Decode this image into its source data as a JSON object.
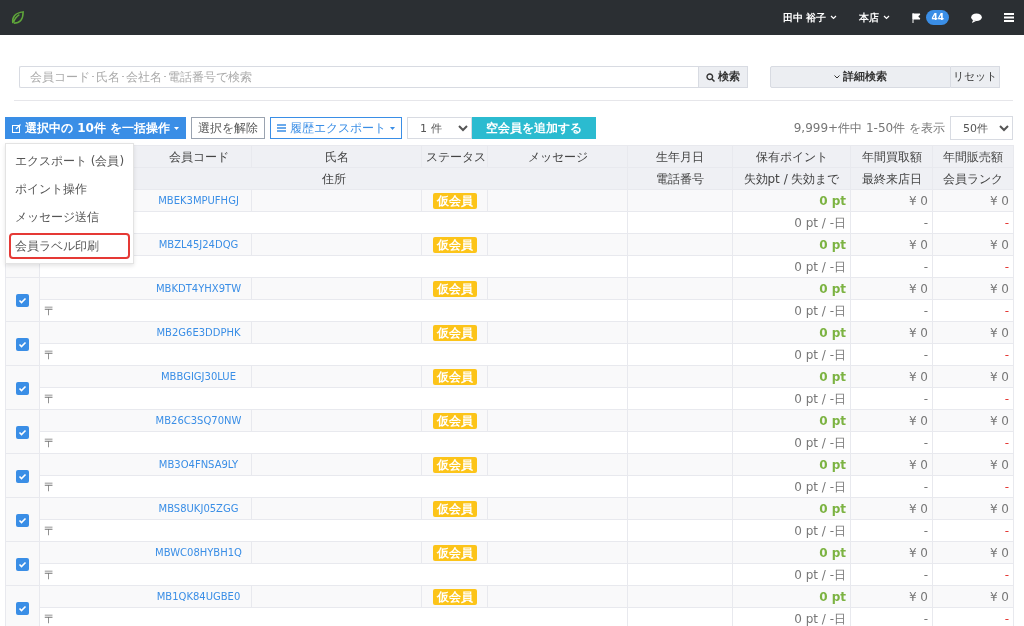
{
  "navbar": {
    "user": "田中 裕子",
    "store": "本店",
    "notification_count": "44"
  },
  "search": {
    "placeholder": "会員コード･氏名･会社名･電話番号で検索",
    "button": "検索",
    "advanced_button": "詳細検索",
    "reset_button": "リセット"
  },
  "toolbar": {
    "bulk_button": "選択中の 10件 を一括操作",
    "clear_button": "選択を解除",
    "export_button": "履歴エクスポート",
    "count_select": "1 件",
    "add_button": "空会員を追加する",
    "summary": "9,999+件中 1-50件 を表示",
    "page_size": "50件"
  },
  "bulk_menu": {
    "items": [
      {
        "label": "エクスポート (会員)",
        "selected": false
      },
      {
        "label": "ポイント操作",
        "selected": false
      },
      {
        "label": "メッセージ送信",
        "selected": false
      },
      {
        "label": "会員ラベル印刷",
        "selected": true
      }
    ]
  },
  "table": {
    "columns_top": [
      "会員コード",
      "氏名",
      "ステータス",
      "メッセージ",
      "生年月日",
      "保有ポイント",
      "年間買取額",
      "年間販売額"
    ],
    "columns_bottom": [
      "住所",
      "電話番号",
      "失効pt / 失効まで",
      "最終来店日",
      "会員ランク"
    ],
    "rows": [
      {
        "code": "MBEK3MPUFHGJ",
        "status": "仮会員",
        "points": "0 pt",
        "purchase": "¥ 0",
        "sales": "¥ 0",
        "expire": "0 pt / -日",
        "last_visit": "-",
        "rank": "-"
      },
      {
        "code": "MBZL45J24DQG",
        "status": "仮会員",
        "points": "0 pt",
        "purchase": "¥ 0",
        "sales": "¥ 0",
        "expire": "0 pt / -日",
        "last_visit": "-",
        "rank": "-"
      },
      {
        "checked": true,
        "code": "MBKDT4YHX9TW",
        "status": "仮会員",
        "points": "0 pt",
        "purchase": "¥ 0",
        "sales": "¥ 0",
        "address": "〒",
        "expire": "0 pt / -日",
        "last_visit": "-",
        "rank": "-"
      },
      {
        "checked": true,
        "code": "MB2G6E3DDPHK",
        "status": "仮会員",
        "points": "0 pt",
        "purchase": "¥ 0",
        "sales": "¥ 0",
        "address": "〒",
        "expire": "0 pt / -日",
        "last_visit": "-",
        "rank": "-"
      },
      {
        "checked": true,
        "code": "MBBGIGJ30LUE",
        "status": "仮会員",
        "points": "0 pt",
        "purchase": "¥ 0",
        "sales": "¥ 0",
        "address": "〒",
        "expire": "0 pt / -日",
        "last_visit": "-",
        "rank": "-"
      },
      {
        "checked": true,
        "code": "MB26C3SQ70NW",
        "status": "仮会員",
        "points": "0 pt",
        "purchase": "¥ 0",
        "sales": "¥ 0",
        "address": "〒",
        "expire": "0 pt / -日",
        "last_visit": "-",
        "rank": "-"
      },
      {
        "checked": true,
        "code": "MB3O4FNSA9LY",
        "status": "仮会員",
        "points": "0 pt",
        "purchase": "¥ 0",
        "sales": "¥ 0",
        "address": "〒",
        "expire": "0 pt / -日",
        "last_visit": "-",
        "rank": "-"
      },
      {
        "checked": true,
        "code": "MBS8UKJ05ZGG",
        "status": "仮会員",
        "points": "0 pt",
        "purchase": "¥ 0",
        "sales": "¥ 0",
        "address": "〒",
        "expire": "0 pt / -日",
        "last_visit": "-",
        "rank": "-"
      },
      {
        "checked": true,
        "code": "MBWC08HYBH1Q",
        "status": "仮会員",
        "points": "0 pt",
        "purchase": "¥ 0",
        "sales": "¥ 0",
        "address": "〒",
        "expire": "0 pt / -日",
        "last_visit": "-",
        "rank": "-"
      },
      {
        "checked": true,
        "code": "MB1QK84UGBE0",
        "status": "仮会員",
        "points": "0 pt",
        "purchase": "¥ 0",
        "sales": "¥ 0",
        "address": "〒",
        "expire": "0 pt / -日",
        "last_visit": "-",
        "rank": "-"
      }
    ]
  }
}
